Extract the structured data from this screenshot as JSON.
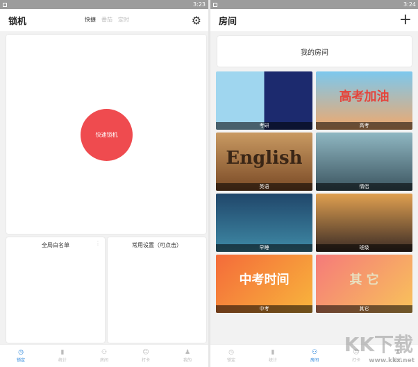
{
  "left": {
    "status_time": "3:23",
    "title": "锁机",
    "tabs": [
      "快捷",
      "番茄",
      "定时"
    ],
    "active_tab": 0,
    "lock_button": "快速锁机",
    "whitelist_title": "全局白名单",
    "settings_title": "常用设置（可点击）"
  },
  "right": {
    "status_time": "3:24",
    "title": "房间",
    "my_room": "我的房间",
    "rooms": [
      {
        "label": "考研",
        "banner": ""
      },
      {
        "label": "高考",
        "banner": "高考加油"
      },
      {
        "label": "英语",
        "banner": "English"
      },
      {
        "label": "情侣",
        "banner": ""
      },
      {
        "label": "早睡",
        "banner": ""
      },
      {
        "label": "班级",
        "banner": ""
      },
      {
        "label": "中考",
        "banner": "中考时间"
      },
      {
        "label": "其它",
        "banner": "其 它"
      }
    ]
  },
  "nav": [
    {
      "label": "锁定",
      "icon": "clock-icon"
    },
    {
      "label": "统计",
      "icon": "bar-chart-icon"
    },
    {
      "label": "房间",
      "icon": "group-icon"
    },
    {
      "label": "打卡",
      "icon": "smile-icon"
    },
    {
      "label": "我的",
      "icon": "person-icon"
    }
  ],
  "watermark": {
    "logo": "KK下载",
    "url": "www.kkx.net"
  },
  "colors": {
    "accent": "#1e7ed8",
    "lock": "#ef4b4f"
  }
}
